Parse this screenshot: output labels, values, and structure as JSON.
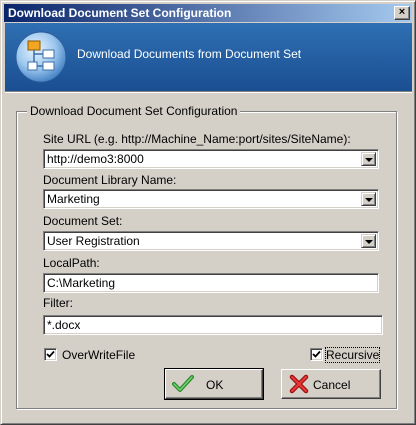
{
  "window": {
    "title": "Download Document Set Configuration",
    "close_glyph": "×"
  },
  "banner": {
    "icon": "sitemap-icon",
    "text": "Download Documents from Document Set"
  },
  "group": {
    "legend": "Download Document Set Configuration"
  },
  "fields": {
    "site_url": {
      "label": "Site URL (e.g. http://Machine_Name:port/sites/SiteName):",
      "value": "http://demo3:8000"
    },
    "doc_library": {
      "label": "Document Library Name:",
      "value": "Marketing"
    },
    "doc_set": {
      "label": "Document Set:",
      "value": "User Registration"
    },
    "local_path": {
      "label": "LocalPath:",
      "value": "C:\\Marketing"
    },
    "filter": {
      "label": "Filter:",
      "value": "*.docx"
    }
  },
  "checkboxes": {
    "overwrite": {
      "label": "OverWriteFile",
      "checked": true
    },
    "recursive": {
      "label": "Recursive",
      "checked": true
    }
  },
  "buttons": {
    "ok": {
      "label": "OK",
      "icon": "checkmark-icon"
    },
    "cancel": {
      "label": "Cancel",
      "icon": "red-x-icon"
    }
  },
  "colors": {
    "title_bar_start": "#0a246a",
    "title_bar_end": "#a6caf0",
    "banner_bg": "#2462a8",
    "dialog_bg": "#d4d0c8",
    "ok_icon": "#3aa63a",
    "cancel_icon": "#d42020"
  }
}
